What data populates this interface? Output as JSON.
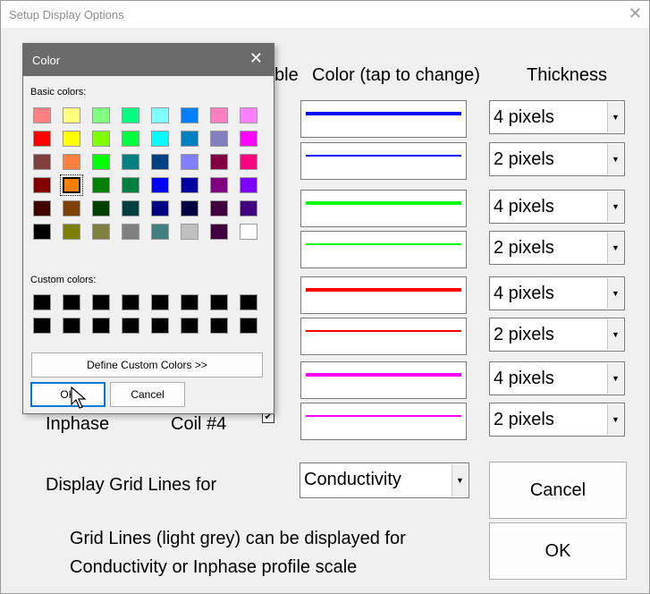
{
  "window": {
    "title": "Setup Display Options",
    "close_glyph": "✕"
  },
  "headers": {
    "enable_partial": "ble",
    "color": "Color (tap to change)",
    "thickness": "Thickness"
  },
  "rows": [
    {
      "color": "#0000ff",
      "thickness": "4 pixels"
    },
    {
      "color": "#0000ff",
      "thickness": "2 pixels"
    },
    {
      "color": "#00ff00",
      "thickness": "4 pixels"
    },
    {
      "color": "#00ff00",
      "thickness": "2 pixels"
    },
    {
      "color": "#ff0000",
      "thickness": "4 pixels"
    },
    {
      "color": "#ff0000",
      "thickness": "2 pixels"
    },
    {
      "color": "#ff00ff",
      "thickness": "4 pixels"
    },
    {
      "color": "#ff00ff",
      "thickness": "2 pixels"
    }
  ],
  "last_row_labels": {
    "type": "Inphase",
    "coil": "Coil #4",
    "check": "✔"
  },
  "grid_lines": {
    "label": "Display Grid Lines for",
    "selected": "Conductivity",
    "note_line1": "Grid Lines (light grey) can be displayed for",
    "note_line2": "Conductivity or Inphase profile scale"
  },
  "buttons": {
    "cancel": "Cancel",
    "ok": "OK"
  },
  "color_dialog": {
    "title": "Color",
    "close_glyph": "✕",
    "basic_label": "Basic colors:",
    "custom_label": "Custom colors:",
    "define_label": "Define Custom Colors >>",
    "ok_label": "OK",
    "cancel_label": "Cancel",
    "selected_color": "#ff8000",
    "basic_colors": [
      "#ff8080",
      "#ffff80",
      "#80ff80",
      "#00ff80",
      "#80ffff",
      "#0080ff",
      "#ff80c0",
      "#ff80ff",
      "#ff0000",
      "#ffff00",
      "#80ff00",
      "#00ff40",
      "#00ffff",
      "#0080c0",
      "#8080c0",
      "#ff00ff",
      "#804040",
      "#ff8040",
      "#00ff00",
      "#008080",
      "#004080",
      "#8080ff",
      "#800040",
      "#ff0080",
      "#800000",
      "#ff8000",
      "#008000",
      "#008040",
      "#0000ff",
      "#0000a0",
      "#800080",
      "#8000ff",
      "#400000",
      "#804000",
      "#004000",
      "#004040",
      "#000080",
      "#000040",
      "#400040",
      "#400080",
      "#000000",
      "#808000",
      "#808040",
      "#808080",
      "#408080",
      "#c0c0c0",
      "#400040",
      "#ffffff"
    ],
    "custom_colors": [
      "#000000",
      "#000000",
      "#000000",
      "#000000",
      "#000000",
      "#000000",
      "#000000",
      "#000000",
      "#000000",
      "#000000",
      "#000000",
      "#000000",
      "#000000",
      "#000000",
      "#000000",
      "#000000"
    ]
  },
  "arrow_glyph": "▼"
}
